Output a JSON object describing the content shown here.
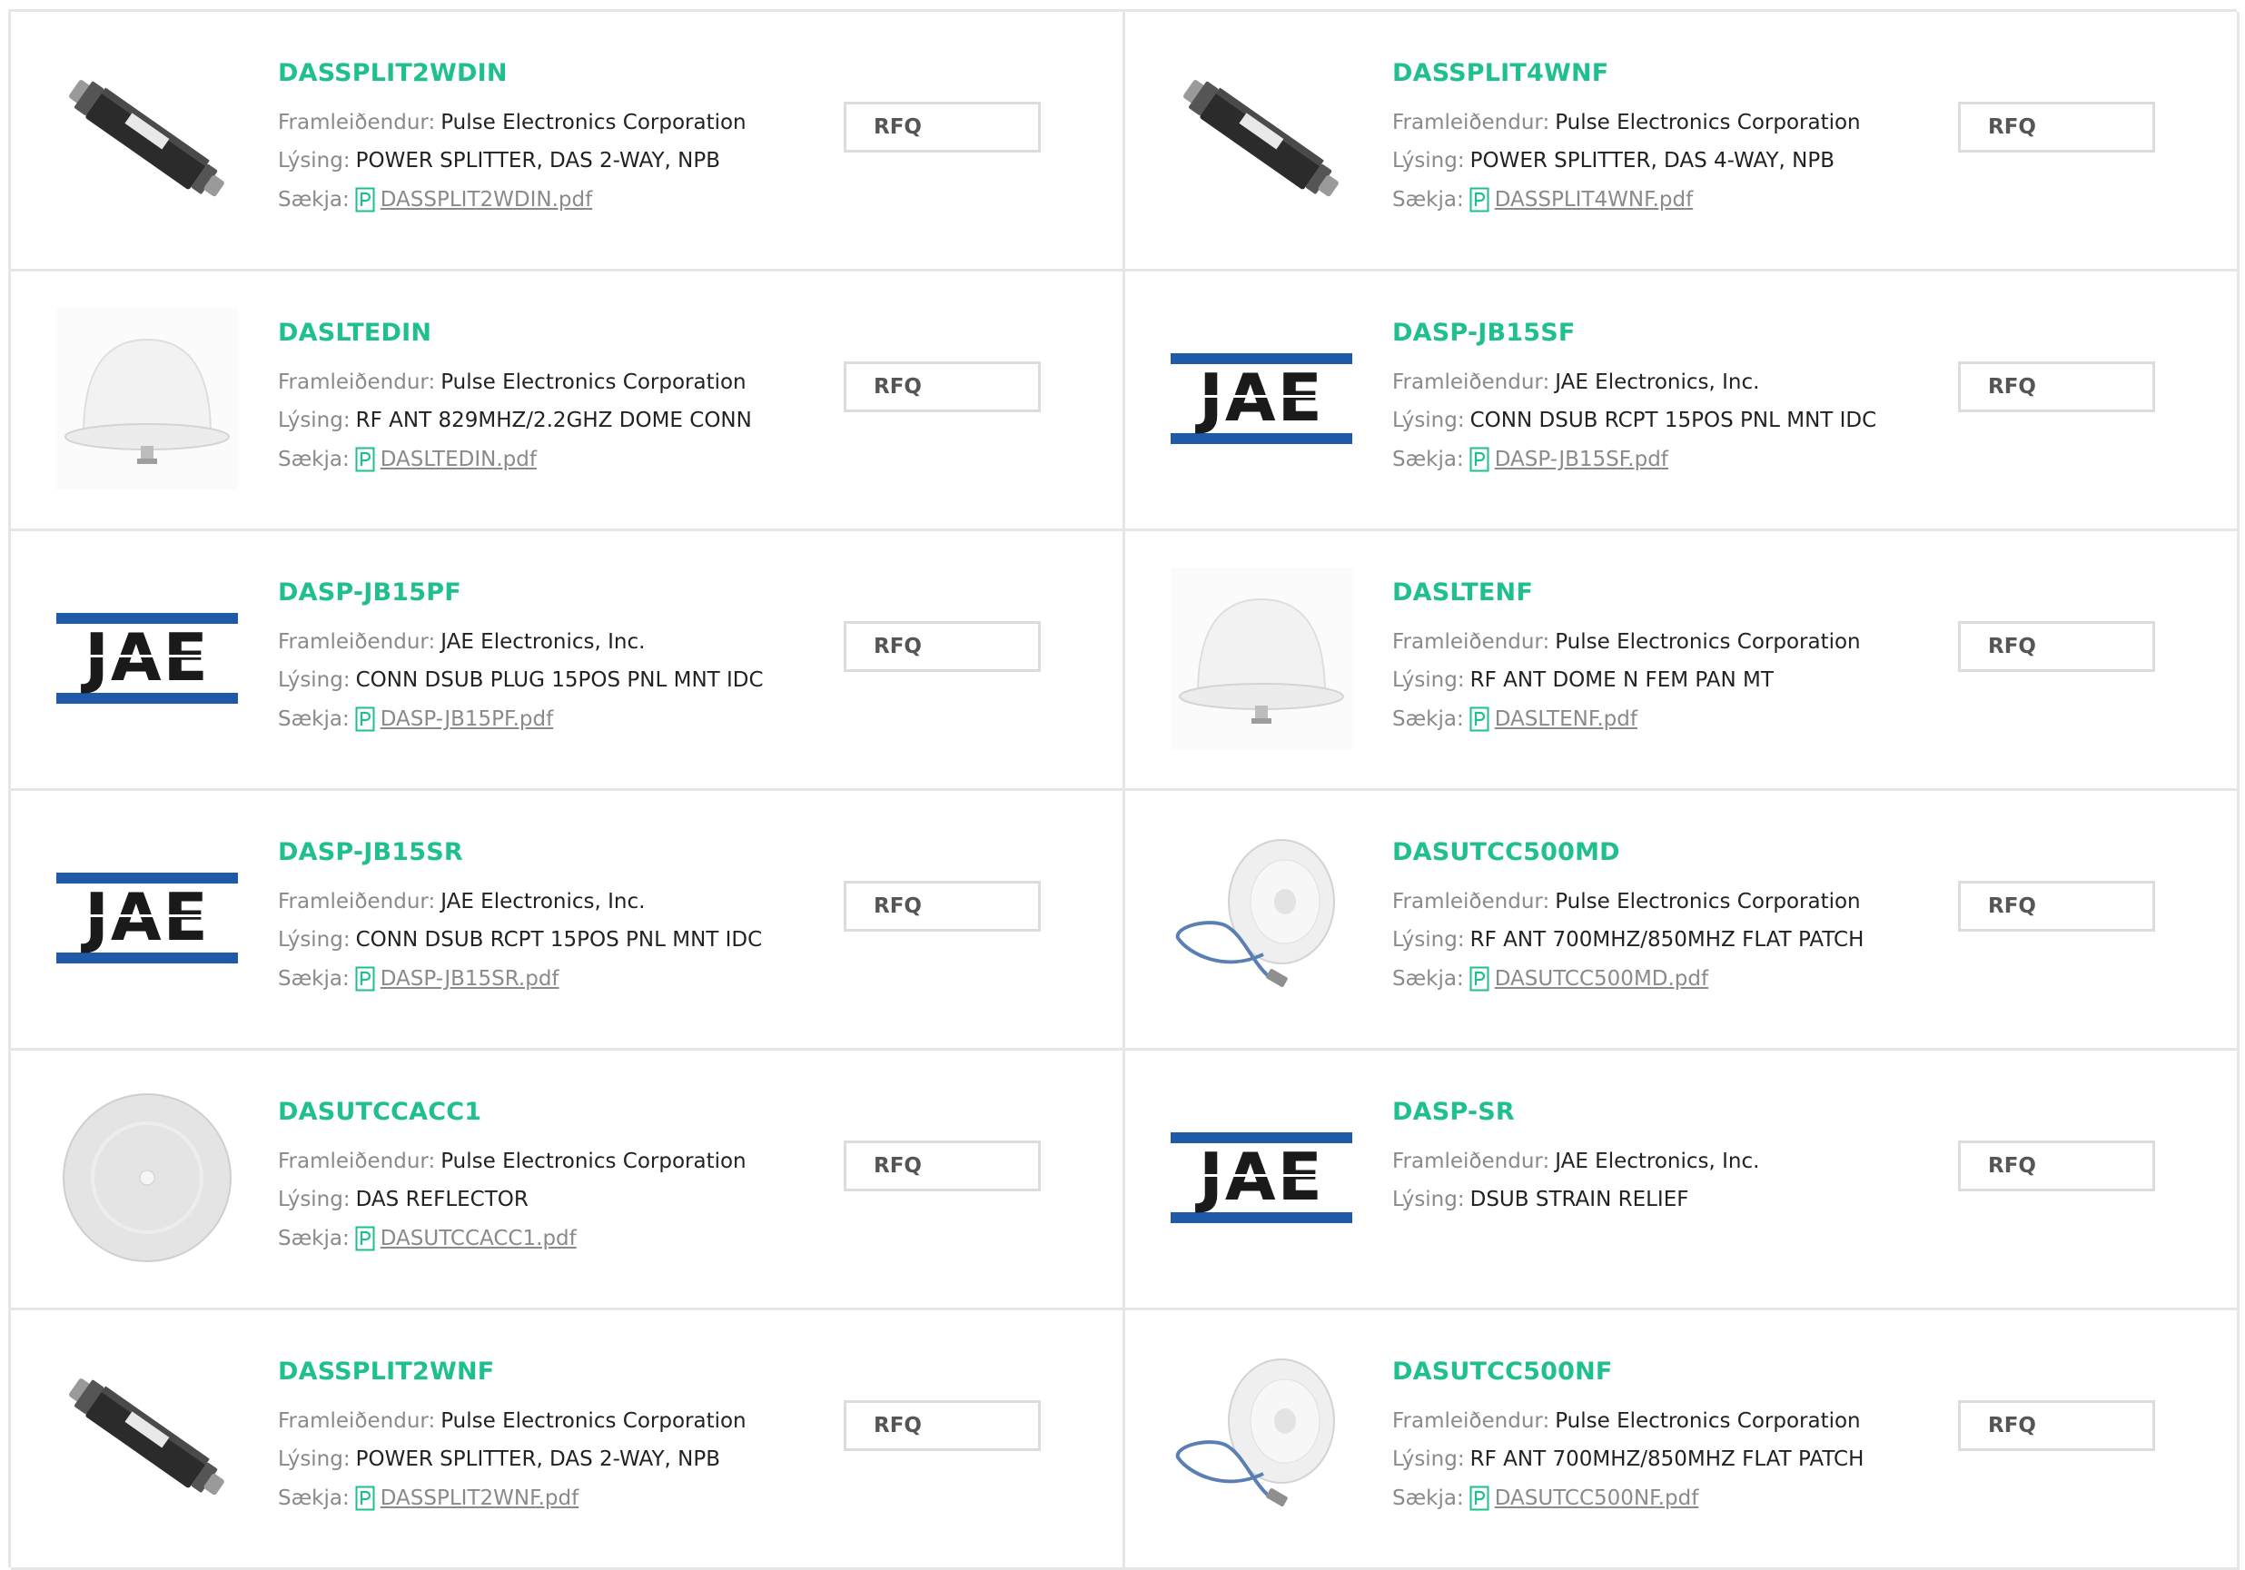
{
  "labels": {
    "manufacturer": "Framleiðendur:",
    "description": "Lýsing:",
    "download": "Sækja:",
    "rfq": "RFQ",
    "jae_logo_text": "JAE"
  },
  "colors": {
    "part_link": "#1fbf8f",
    "jae_blue": "#1e5aa8",
    "pdf_icon": "#1fbf8f"
  },
  "products": [
    {
      "part": "DASSPLIT2WDIN",
      "manufacturer": "Pulse Electronics Corporation",
      "description": "POWER SPLITTER, DAS 2-WAY, NPB",
      "pdf": "DASSPLIT2WDIN.pdf",
      "image": "splitter"
    },
    {
      "part": "DASSPLIT4WNF",
      "manufacturer": "Pulse Electronics Corporation",
      "description": "POWER SPLITTER, DAS 4-WAY, NPB",
      "pdf": "DASSPLIT4WNF.pdf",
      "image": "splitter"
    },
    {
      "part": "DASLTEDIN",
      "manufacturer": "Pulse Electronics Corporation",
      "description": "RF ANT 829MHZ/2.2GHZ DOME CONN",
      "pdf": "DASLTEDIN.pdf",
      "image": "dome"
    },
    {
      "part": "DASP-JB15SF",
      "manufacturer": "JAE Electronics, Inc.",
      "description": "CONN DSUB RCPT 15POS PNL MNT IDC",
      "pdf": "DASP-JB15SF.pdf",
      "image": "jae-logo"
    },
    {
      "part": "DASP-JB15PF",
      "manufacturer": "JAE Electronics, Inc.",
      "description": "CONN DSUB PLUG 15POS PNL MNT IDC",
      "pdf": "DASP-JB15PF.pdf",
      "image": "jae-logo"
    },
    {
      "part": "DASLTENF",
      "manufacturer": "Pulse Electronics Corporation",
      "description": "RF ANT DOME N FEM PAN MT",
      "pdf": "DASLTENF.pdf",
      "image": "dome"
    },
    {
      "part": "DASP-JB15SR",
      "manufacturer": "JAE Electronics, Inc.",
      "description": "CONN DSUB RCPT 15POS PNL MNT IDC",
      "pdf": "DASP-JB15SR.pdf",
      "image": "jae-logo"
    },
    {
      "part": "DASUTCC500MD",
      "manufacturer": "Pulse Electronics Corporation",
      "description": "RF ANT 700MHZ/850MHZ FLAT PATCH",
      "pdf": "DASUTCC500MD.pdf",
      "image": "patch-antenna"
    },
    {
      "part": "DASUTCCACC1",
      "manufacturer": "Pulse Electronics Corporation",
      "description": "DAS REFLECTOR",
      "pdf": "DASUTCCACC1.pdf",
      "image": "reflector"
    },
    {
      "part": "DASP-SR",
      "manufacturer": "JAE Electronics, Inc.",
      "description": "DSUB STRAIN RELIEF",
      "pdf": "",
      "image": "jae-logo"
    },
    {
      "part": "DASSPLIT2WNF",
      "manufacturer": "Pulse Electronics Corporation",
      "description": "POWER SPLITTER, DAS 2-WAY, NPB",
      "pdf": "DASSPLIT2WNF.pdf",
      "image": "splitter"
    },
    {
      "part": "DASUTCC500NF",
      "manufacturer": "Pulse Electronics Corporation",
      "description": "RF ANT 700MHZ/850MHZ FLAT PATCH",
      "pdf": "DASUTCC500NF.pdf",
      "image": "patch-antenna"
    }
  ]
}
